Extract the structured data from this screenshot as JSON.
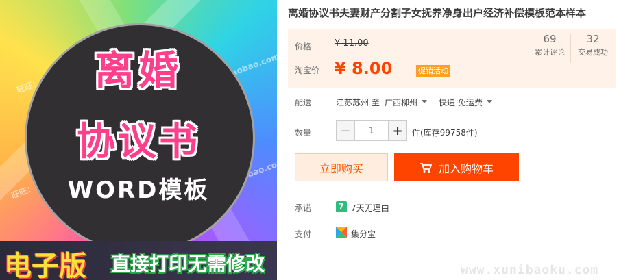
{
  "image": {
    "title_line1": "离婚",
    "title_line2": "协议书",
    "title_line3": "WORD模板",
    "banner_left": "电子版",
    "banner_right": "直接打印无需修改",
    "watermark": "旺旺：hoplanlaobao.com"
  },
  "product": {
    "title": "离婚协议书夫妻财产分割子女抚养净身出户经济补偿模板范本样本"
  },
  "price": {
    "orig_label": "价格",
    "orig_value": "¥ 11.00",
    "taobao_label": "淘宝价",
    "taobao_value": "¥ 8.00",
    "promo_badge": "促销活动"
  },
  "stats": [
    {
      "num": "69",
      "label": "累计评论"
    },
    {
      "num": "32",
      "label": "交易成功"
    }
  ],
  "shipping": {
    "label": "配送",
    "from": "江苏苏州 至",
    "to": "广西柳州",
    "method": "快递 免运费"
  },
  "quantity": {
    "label": "数量",
    "minus": "−",
    "value": "1",
    "plus": "+",
    "stock": "件(库存99758件)"
  },
  "actions": {
    "buy_now": "立即购买",
    "add_cart": "加入购物车"
  },
  "promise": {
    "label": "承诺",
    "icon_text": "7",
    "text": "7天无理由"
  },
  "payment": {
    "label": "支付",
    "text": "集分宝"
  },
  "site_watermark": "www.xunibaoku.com",
  "colors": {
    "accent": "#ff4400",
    "price_bg": "#fff2e8",
    "promo": "#ffa01e"
  }
}
